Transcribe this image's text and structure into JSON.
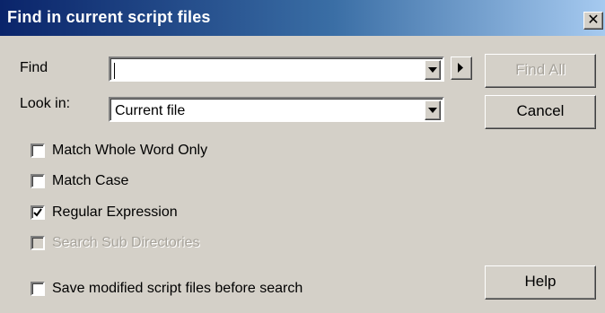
{
  "window": {
    "title": "Find in current script files",
    "close_symbol": "✕"
  },
  "find": {
    "label": "Find",
    "value": ""
  },
  "look_in": {
    "label": "Look in:",
    "value": "Current file"
  },
  "buttons": {
    "find_all": "Find All",
    "cancel": "Cancel",
    "help": "Help"
  },
  "options": {
    "match_whole_word": {
      "label": "Match Whole Word Only",
      "checked": false
    },
    "match_case": {
      "label": "Match Case",
      "checked": false
    },
    "regular_expression": {
      "label": "Regular Expression",
      "checked": true
    },
    "search_sub_directories": {
      "label": "Search Sub Directories",
      "checked": false,
      "disabled": true
    },
    "save_modified": {
      "label": "Save modified script files before search",
      "checked": false
    }
  }
}
